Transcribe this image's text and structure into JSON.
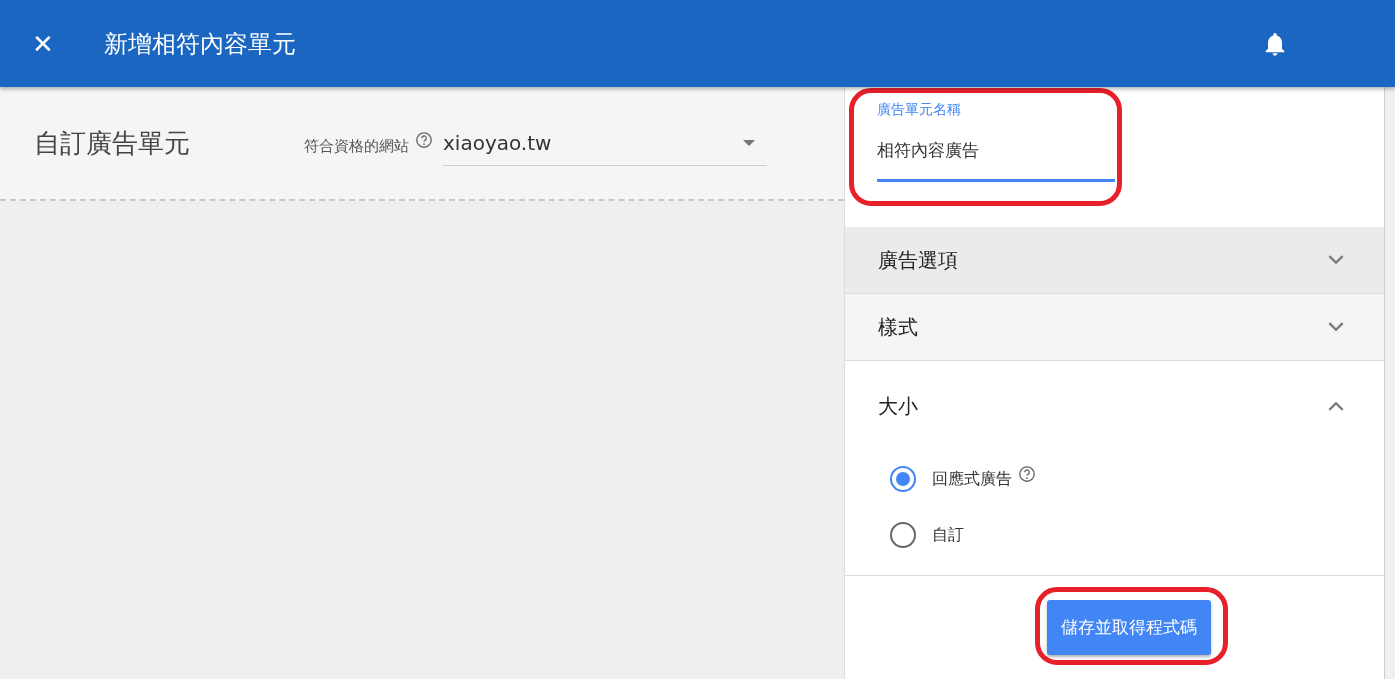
{
  "header": {
    "close_icon": "✕",
    "title": "新增相符內容單元"
  },
  "left": {
    "title": "自訂廣告單元",
    "site_label": "符合資格的網站",
    "site_value": "xiaoyao.tw"
  },
  "name_field": {
    "label": "廣告單元名稱",
    "value": "相符內容廣告",
    "highlighted": true
  },
  "sections": [
    {
      "label": "廣告選項",
      "expanded": false,
      "color": "#ebebeb"
    },
    {
      "label": "樣式",
      "expanded": false,
      "color": "#f5f5f5"
    },
    {
      "label": "大小",
      "expanded": true,
      "color": "#ffffff"
    }
  ],
  "size_options": [
    {
      "label": "回應式廣告",
      "selected": true,
      "help": true
    },
    {
      "label": "自訂",
      "selected": false,
      "help": false
    }
  ],
  "save_button": {
    "label": "儲存並取得程式碼",
    "highlighted": true
  }
}
